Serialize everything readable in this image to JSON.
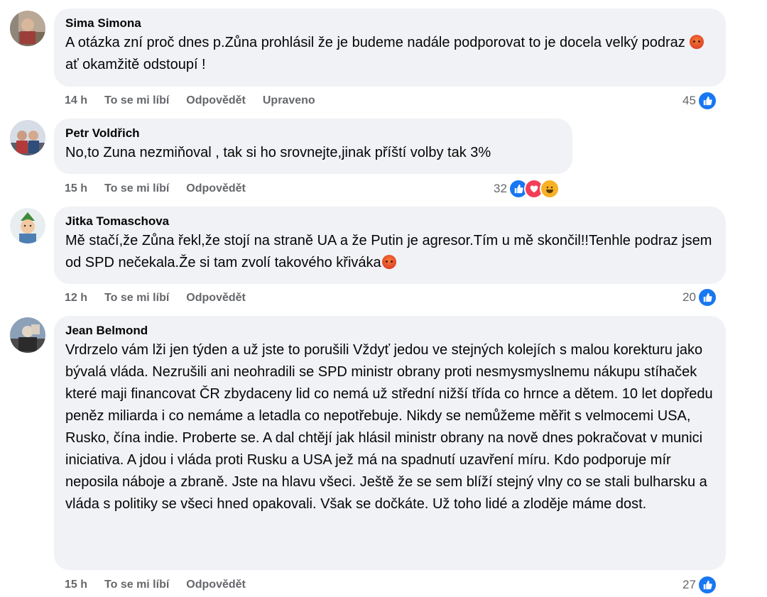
{
  "comments": [
    {
      "author": "Sima Simona",
      "text_before_emoji": "A otázka zní proč dnes p.Zůna prohlásil že je budeme nadále podporovat to je docela velký podraz ",
      "emoji": "angry-face",
      "text_after_emoji": "ať okamžitě odstoupí !",
      "time": "14 h",
      "like_label": "To se mi líbí",
      "reply_label": "Odpovědět",
      "edited_label": "Upraveno",
      "reaction_count": "45",
      "reactions": [
        "like-icon"
      ]
    },
    {
      "author": "Petr Voldřich",
      "text": "No,to Zuna nezmiňoval , tak si ho srovnejte,jinak příští volby tak 3%",
      "time": "15 h",
      "like_label": "To se mi líbí",
      "reply_label": "Odpovědět",
      "reaction_count": "32",
      "reactions": [
        "like-icon",
        "love-icon",
        "haha-icon"
      ]
    },
    {
      "author": "Jitka Tomaschova",
      "text_before_emoji": "Mě stačí,že Zůna řekl,že stojí na straně UA a že Putin je agresor.Tím u mě skončil!!Tenhle podraz jsem od SPD nečekala.Že si tam zvolí takového křiváka",
      "emoji": "angry-face",
      "time": "12 h",
      "like_label": "To se mi líbí",
      "reply_label": "Odpovědět",
      "reaction_count": "20",
      "reactions": [
        "like-icon"
      ]
    },
    {
      "author": "Jean Belmond",
      "text": "Vrdrzelo vám lži jen týden a už jste to porušili Vždyť jedou ve stejných kolejích s malou korekturu jako bývalá vláda. Nezrušili ani neohradili se SPD ministr obrany proti nesmysmyslnemu nákupu stíhaček které maji financovat ČR zbydaceny lid co nemá už střední nižší třída co hrnce a dětem. 10 let dopředu peněz miliarda i co nemáme a letadla co nepotřebuje. Nikdy se nemůžeme měřit s velmocemi USA, Rusko, čína indie. Proberte se. A dal chtějí jak hlásil ministr obrany na nově dnes pokračovat v munici iniciativa. A jdou i vláda proti Rusku a USA jež má na spadnutí uzavření míru. Kdo podporuje mír neposila náboje a zbraně. Jste na hlavu všeci. Ještě že se sem blíží stejný vlny co se stali bulharsku a vláda s politiky se všeci hned opakovali. Však se dočkáte. Už toho lidé a zloděje máme dost.",
      "time": "15 h",
      "like_label": "To se mi líbí",
      "reply_label": "Odpovědět",
      "reaction_count": "27",
      "reactions": [
        "like-icon"
      ]
    }
  ],
  "colors": {
    "bubble": "#f0f2f5",
    "meta_text": "#65676b",
    "like_blue": "#1877f2",
    "love_red": "#f33e58",
    "haha_yellow": "#f7b125"
  }
}
